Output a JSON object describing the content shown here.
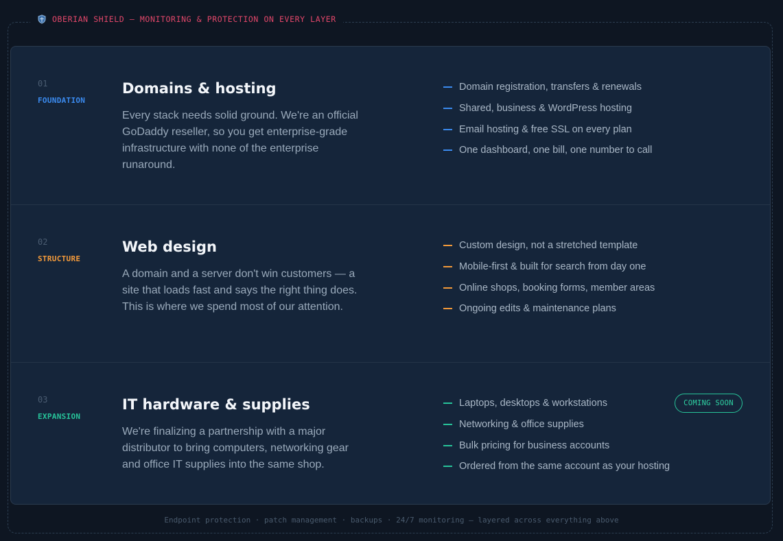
{
  "header": {
    "title": "OBERIAN SHIELD — MONITORING & PROTECTION ON EVERY LAYER",
    "icon": "shield-icon"
  },
  "sections": [
    {
      "number": "01",
      "tag": "FOUNDATION",
      "accent": "#3b8bef",
      "title": "Domains & hosting",
      "description": "Every stack needs solid ground. We're an official GoDaddy reseller, so you get enterprise-grade infrastructure with none of the enterprise runaround.",
      "bullets": [
        "Domain registration, transfers & renewals",
        "Shared, business & WordPress hosting",
        "Email hosting & free SSL on every plan",
        "One dashboard, one bill, one number to call"
      ]
    },
    {
      "number": "02",
      "tag": "STRUCTURE",
      "accent": "#f39a3a",
      "title": "Web design",
      "description": "A domain and a server don't win customers — a site that loads fast and says the right thing does. This is where we spend most of our attention.",
      "bullets": [
        "Custom design, not a stretched template",
        "Mobile-first & built for search from day one",
        "Online shops, booking forms, member areas",
        "Ongoing edits & maintenance plans"
      ]
    },
    {
      "number": "03",
      "tag": "EXPANSION",
      "accent": "#27c49a",
      "title": "IT hardware & supplies",
      "description": "We're finalizing a partnership with a major distributor to bring computers, networking gear and office IT supplies into the same shop.",
      "badge": "COMING SOON",
      "bullets": [
        "Laptops, desktops & workstations",
        "Networking & office supplies",
        "Bulk pricing for business accounts",
        "Ordered from the same account as your hosting"
      ]
    }
  ],
  "footer": "Endpoint protection · patch management · backups · 24/7 monitoring — layered across everything above"
}
